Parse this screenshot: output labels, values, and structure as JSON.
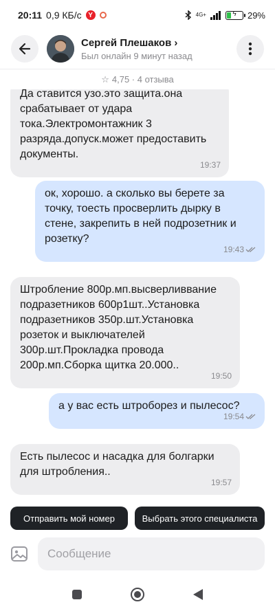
{
  "status": {
    "time": "20:11",
    "speed": "0,9 КБ/с",
    "yandex": "Y",
    "network": "4G+",
    "battery": "29%",
    "battery_level": 0.29
  },
  "header": {
    "name": "Сергей Плешаков",
    "chevron": "›",
    "last_seen": "Был онлайн 9 минут назад",
    "icons": {
      "back": "back-arrow-icon",
      "menu": "more-vertical-icon"
    }
  },
  "rating": {
    "star": "☆",
    "text": "4,75 · 4 отзыва"
  },
  "messages": [
    {
      "dir": "in",
      "text": "Да ставится узо.это защита.она срабатывает от удара тока.Электромонтажник 3 разряда.допуск.может предоставить документы.",
      "time": "19:37"
    },
    {
      "dir": "out",
      "text": "ок, хорошо. а сколько вы берете за точку, тоесть просверлить дырку в стене, закрепить в ней подрозетник и розетку?",
      "time": "19:43"
    },
    {
      "dir": "in",
      "text": "Штробление 800р.мп.высверливвание подразетников 600р1шт..Установка подразетников 350р.шт.Установка розеток и выключателей 300р.шт.Прокладка провода 200р.мп.Сборка щитка 20.000..",
      "time": "19:50"
    },
    {
      "dir": "out",
      "text": "а у вас есть штроборез и пылесос?",
      "time": "19:54"
    },
    {
      "dir": "in",
      "text": "Есть пылесос и насадка для болгарки для штробления..",
      "time": "19:57"
    }
  ],
  "actions": {
    "send_number": "Отправить мой номер",
    "choose_specialist": "Выбрать этого специалиста"
  },
  "composer": {
    "placeholder": "Сообщение",
    "icon": "image-attach-icon"
  },
  "navbar": {
    "icons": [
      "recent-apps-icon",
      "home-icon",
      "back-triangle-icon"
    ]
  }
}
